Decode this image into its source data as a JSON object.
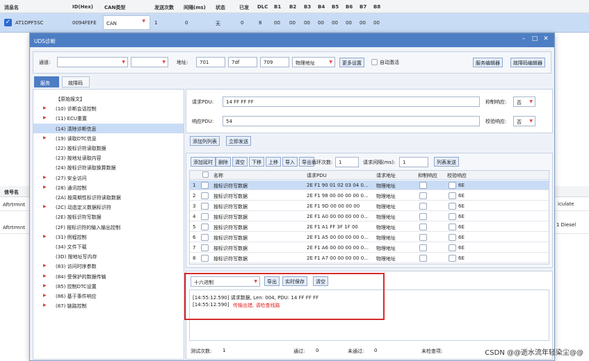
{
  "main_table": {
    "headers": [
      "消息名",
      "ID(Hex)",
      "CAN类型",
      "发送次数",
      "间隔(ms)",
      "状态",
      "已发",
      "DLC",
      "B1",
      "B2",
      "B3",
      "B4",
      "B5",
      "B6",
      "B7",
      "B8"
    ],
    "row": {
      "name": "AT1DPF5SC",
      "id": "0094FEFE",
      "can_type": "CAN",
      "send_count": "1",
      "interval": "0",
      "status": "无",
      "sent": "0",
      "dlc": "8",
      "bytes": [
        "00",
        "00",
        "00",
        "00",
        "00",
        "00",
        "00",
        "00"
      ]
    },
    "lower_header": "信号名",
    "lower_rows": [
      "Aftrtrmnt",
      "Aftrtrmnt"
    ],
    "right_fragments": [
      "iculate",
      "1 Diesel"
    ]
  },
  "dialog": {
    "title": "UDS诊断",
    "toolbar": {
      "channel_label": "通道:",
      "address_label": "地址:",
      "addr1": "701",
      "addr2": "7df",
      "addr3": "709",
      "addr_type": "物理地址",
      "more_settings": "更多设置",
      "auto_keepalive": "自动激活",
      "service_editor": "服务编辑器",
      "fault_editor": "故障码编辑器"
    },
    "tabs": [
      "服务",
      "故障码"
    ],
    "tree": [
      {
        "text": "【原始报文】",
        "arrow": false
      },
      {
        "text": "(10) 诊断会话控制",
        "arrow": true
      },
      {
        "text": "(11) ECU重置",
        "arrow": true
      },
      {
        "text": "(14) 清除诊断信息",
        "arrow": false,
        "selected": true
      },
      {
        "text": "(19) 读取DTC信息",
        "arrow": true
      },
      {
        "text": "(22) 按标识符读取数据",
        "arrow": false
      },
      {
        "text": "(23) 按地址读取内容",
        "arrow": false
      },
      {
        "text": "(24) 按标识符读取换算数据",
        "arrow": false
      },
      {
        "text": "(27) 安全访问",
        "arrow": true
      },
      {
        "text": "(28) 通讯控制",
        "arrow": true
      },
      {
        "text": "(2A) 按周期性标识符读取数据",
        "arrow": false
      },
      {
        "text": "(2C) 动态定义数据标识符",
        "arrow": true
      },
      {
        "text": "(2E) 按标识符写数据",
        "arrow": false
      },
      {
        "text": "(2F) 按标识符的输入输出控制",
        "arrow": false
      },
      {
        "text": "(31) 例程控制",
        "arrow": true
      },
      {
        "text": "(34) 文件下载",
        "arrow": false
      },
      {
        "text": "(3D) 按地址写内存",
        "arrow": false
      },
      {
        "text": "(83) 访问时序参数",
        "arrow": true
      },
      {
        "text": "(84) 受保护的数据传输",
        "arrow": true
      },
      {
        "text": "(85) 控制DTC设置",
        "arrow": true
      },
      {
        "text": "(86) 基于事件响应",
        "arrow": true
      },
      {
        "text": "(87) 链路控制",
        "arrow": true
      }
    ],
    "request": {
      "pdu_label": "请求PDU:",
      "pdu_value": "14 FF FF FF",
      "suppress_label": "抑制响应:",
      "suppress_value": "否",
      "response_label": "响应PDU:",
      "response_value": "54",
      "verify_label": "校验响应:",
      "verify_value": "否",
      "add_list": "添加列列表",
      "send_now": "立即发送"
    },
    "list_toolbar": {
      "buttons": [
        "添加延时",
        "删除",
        "清空",
        "下移",
        "上移",
        "导入",
        "导出"
      ],
      "loop_label": "循环次数:",
      "loop_value": "1",
      "interval_label": "请求间隔(ms):",
      "interval_value": "1",
      "list_send": "列表发送"
    },
    "grid": {
      "headers": [
        "名称",
        "请求PDU",
        "请求地址",
        "抑制响应",
        "校验响应"
      ],
      "rows": [
        {
          "n": "1",
          "name": "按标识符写数据",
          "pdu": "2E F1 90 01 02 03 04 0...",
          "addr": "物理地址",
          "verify": "6E",
          "selected": true
        },
        {
          "n": "2",
          "name": "按标识符写数据",
          "pdu": "2E F1 98 00 00 00 00 0...",
          "addr": "物理地址",
          "verify": "6E"
        },
        {
          "n": "3",
          "name": "按标识符写数据",
          "pdu": "2E F1 9D 00 00 00 00",
          "addr": "物理地址",
          "verify": "6E"
        },
        {
          "n": "4",
          "name": "按标识符写数据",
          "pdu": "2E F1 A0 00 00 00 00 0...",
          "addr": "物理地址",
          "verify": "6E"
        },
        {
          "n": "5",
          "name": "按标识符写数据",
          "pdu": "2E F1 A1 FF 3F 1F 00",
          "addr": "物理地址",
          "verify": "6E"
        },
        {
          "n": "6",
          "name": "按标识符写数据",
          "pdu": "2E F1 A5 00 00 00 00 0...",
          "addr": "物理地址",
          "verify": "6E"
        },
        {
          "n": "7",
          "name": "按标识符写数据",
          "pdu": "2E F1 A6 00 00 00 00 0...",
          "addr": "物理地址",
          "verify": "6E"
        },
        {
          "n": "8",
          "name": "按标识符写数据",
          "pdu": "2E F1 A7 00 00 00 00 0...",
          "addr": "物理地址",
          "verify": "6E"
        }
      ]
    },
    "log": {
      "format": "十六进制",
      "export": "导出",
      "realtime_save": "实时保存",
      "clear": "清空",
      "line1": "[14:55:12.590] 请求数据, Len: 004, PDU: 14 FF FF FF",
      "line2_time": "[14:55:12.590]",
      "line2_err": "传输出错, 请检查线路",
      "border_color": "#d62b2b"
    },
    "status": {
      "tested_label": "测试次数:",
      "tested": "1",
      "passed_label": "通过:",
      "passed": "0",
      "failed_label": "未通过:",
      "failed": "0",
      "unchecked_label": "未检查项:",
      "watermark": "CSDN @@逝水流年轻染尘@@"
    }
  }
}
